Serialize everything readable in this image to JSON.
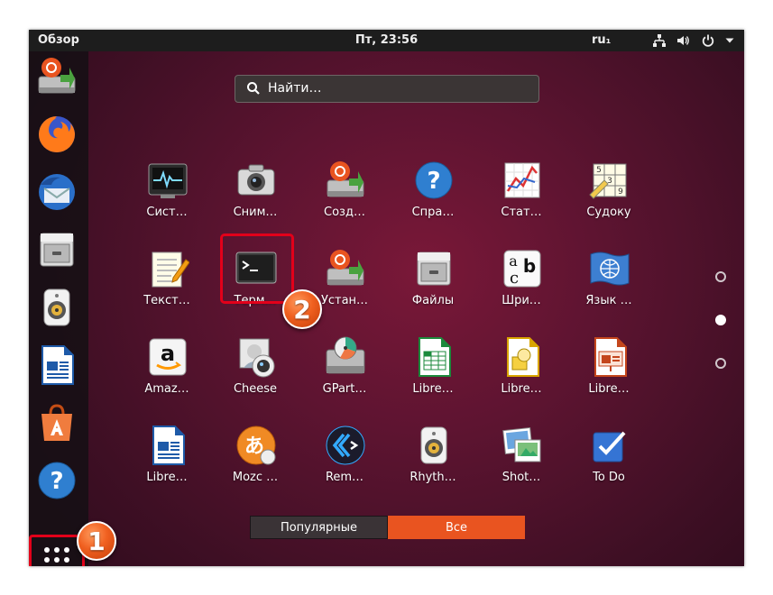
{
  "topbar": {
    "activities": "Обзор",
    "clock": "Пт, 23:56",
    "keyboard_layout": "ru₁",
    "icons": [
      "network-icon",
      "volume-icon",
      "power-icon",
      "chevron-down-icon"
    ]
  },
  "search": {
    "placeholder": "Найти…"
  },
  "apps": [
    {
      "label": "Сист…",
      "icon": "system-monitor-icon"
    },
    {
      "label": "Сним…",
      "icon": "camera-icon"
    },
    {
      "label": "Созд…",
      "icon": "startup-disk-icon"
    },
    {
      "label": "Спра…",
      "icon": "help-icon"
    },
    {
      "label": "Стат…",
      "icon": "statistics-icon"
    },
    {
      "label": "Судоку",
      "icon": "sudoku-icon"
    },
    {
      "label": "Текст…",
      "icon": "text-editor-icon"
    },
    {
      "label": "Терм…",
      "icon": "terminal-icon"
    },
    {
      "label": "Устан…",
      "icon": "installer-icon"
    },
    {
      "label": "Файлы",
      "icon": "files-icon"
    },
    {
      "label": "Шри…",
      "icon": "fonts-icon"
    },
    {
      "label": "Язык …",
      "icon": "language-icon"
    },
    {
      "label": "Amaz…",
      "icon": "amazon-icon"
    },
    {
      "label": "Cheese",
      "icon": "cheese-webcam-icon"
    },
    {
      "label": "GPart…",
      "icon": "gparted-icon"
    },
    {
      "label": "Libre…",
      "icon": "libreoffice-calc-icon"
    },
    {
      "label": "Libre…",
      "icon": "libreoffice-draw-icon"
    },
    {
      "label": "Libre…",
      "icon": "libreoffice-impress-icon"
    },
    {
      "label": "Libre…",
      "icon": "libreoffice-writer-icon"
    },
    {
      "label": "Mozc …",
      "icon": "mozc-icon"
    },
    {
      "label": "Rem…",
      "icon": "remmina-icon"
    },
    {
      "label": "Rhyth…",
      "icon": "rhythmbox-icon"
    },
    {
      "label": "Shot…",
      "icon": "shotwell-icon"
    },
    {
      "label": "To Do",
      "icon": "todo-icon"
    }
  ],
  "dock": [
    "startup-disk-icon",
    "firefox-icon",
    "thunderbird-icon",
    "files-icon",
    "rhythmbox-icon",
    "libreoffice-writer-icon",
    "software-center-icon",
    "help-icon"
  ],
  "switcher": {
    "frequent": "Популярные",
    "all": "Все",
    "active": "all"
  },
  "pages": {
    "count": 3,
    "current": 2
  },
  "annotations": {
    "badge_1": "1",
    "badge_2": "2"
  },
  "colors": {
    "accent": "#e95420",
    "highlight": "#e2001a",
    "topbar": "#1d1d1d"
  }
}
